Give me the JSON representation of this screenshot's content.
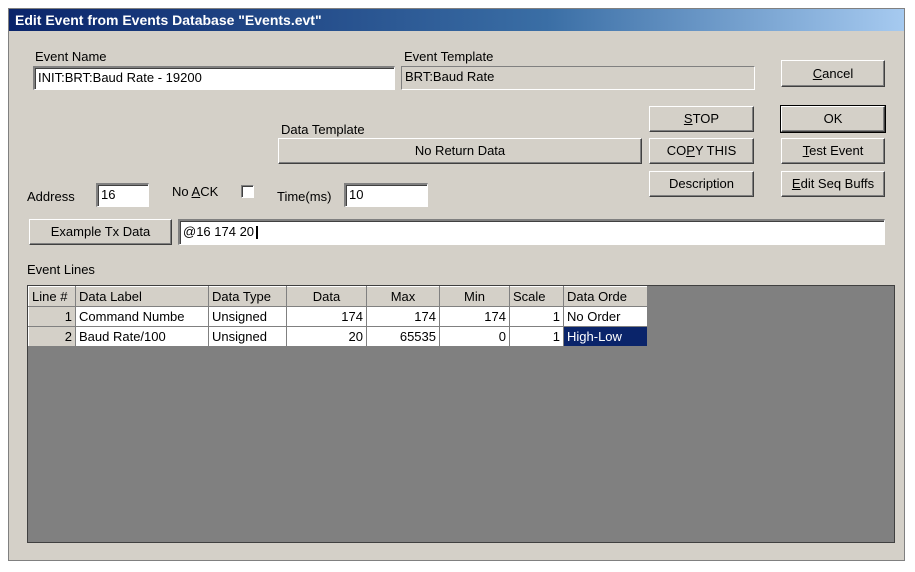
{
  "window": {
    "title": "Edit Event from Events Database \"Events.evt\""
  },
  "event_name": {
    "label": "Event Name",
    "value": "INIT:BRT:Baud Rate - 19200"
  },
  "event_template": {
    "label": "Event Template",
    "value": "BRT:Baud Rate"
  },
  "data_template": {
    "label": "Data Template",
    "value": "No Return Data"
  },
  "address": {
    "label": "Address",
    "value": "16"
  },
  "no_ack": {
    "label_pre": "No ",
    "label_ul": "A",
    "label_post": "CK",
    "checked": false
  },
  "time_ms": {
    "label": "Time(ms)",
    "value": "10"
  },
  "example": {
    "button": "Example Tx Data",
    "value": "@16 174 20"
  },
  "buttons": {
    "cancel_ul": "C",
    "cancel_rest": "ancel",
    "stop_ul": "S",
    "stop_rest": "TOP",
    "ok": "OK",
    "copy_pre": "CO",
    "copy_ul": "P",
    "copy_rest": "Y THIS",
    "test_ul": "T",
    "test_rest": "est Event",
    "description": "Description",
    "editseq_ul": "E",
    "editseq_rest": "dit Seq Buffs"
  },
  "event_lines": {
    "label": "Event Lines",
    "columns": [
      "Line #",
      "Data Label",
      "Data Type",
      "Data",
      "Max",
      "Min",
      "Scale",
      "Data Orde"
    ],
    "rows": [
      [
        "1",
        "Command Numbe",
        "Unsigned",
        "174",
        "174",
        "174",
        "1",
        "No Order"
      ],
      [
        "2",
        "Baud Rate/100",
        "Unsigned",
        "20",
        "65535",
        "0",
        "1",
        "High-Low"
      ]
    ]
  },
  "colors": {
    "titlebar": "#0a246a",
    "face": "#d4d0c8",
    "selection": "#0a246a",
    "grid_bg": "#808080"
  }
}
